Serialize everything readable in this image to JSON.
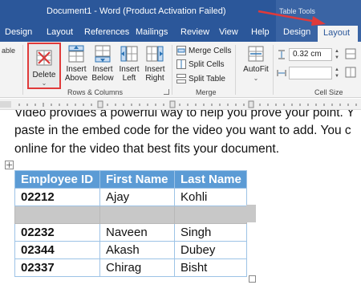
{
  "window": {
    "title": "Document1 - Word (Product Activation Failed)",
    "context_tab_group": "Table Tools"
  },
  "tabs": [
    "Design",
    "Layout",
    "References",
    "Mailings",
    "Review",
    "View",
    "Help"
  ],
  "context_tabs": [
    "Design",
    "Layout"
  ],
  "active_tab": "Layout",
  "ribbon": {
    "left_cut_label": "able",
    "delete": {
      "label": "Delete",
      "caret": "⌄"
    },
    "insert_above": {
      "line1": "Insert",
      "line2": "Above"
    },
    "insert_below": {
      "line1": "Insert",
      "line2": "Below"
    },
    "insert_left": {
      "line1": "Insert",
      "line2": "Left"
    },
    "insert_right": {
      "line1": "Insert",
      "line2": "Right"
    },
    "rows_columns_group": "Rows & Columns",
    "merge_cells": "Merge Cells",
    "split_cells": "Split Cells",
    "split_table": "Split Table",
    "merge_group": "Merge",
    "autofit": {
      "label": "AutoFit",
      "caret": "⌄"
    },
    "height_value": "0.32 cm",
    "width_value": "",
    "cell_size_group": "Cell Size"
  },
  "document": {
    "lines": [
      "Video provides a powerful way to help you prove your point. Y",
      "paste in the embed code for the video you want to add. You c",
      "online for the video that best fits your document."
    ],
    "table": {
      "headers": [
        "Employee ID",
        "First Name",
        "Last Name"
      ],
      "rows": [
        [
          "02212",
          "Ajay",
          "Kohli"
        ],
        [
          "",
          "",
          ""
        ],
        [
          "02232",
          "Naveen",
          "Singh"
        ],
        [
          "02344",
          "Akash",
          "Dubey"
        ],
        [
          "02337",
          "Chirag",
          "Bisht"
        ]
      ],
      "selected_row": 2
    }
  },
  "colors": {
    "word_blue": "#2b579a",
    "table_header": "#5b9bd5",
    "annotation_red": "#e03a3a",
    "selection_gray": "#c8c8c8"
  }
}
